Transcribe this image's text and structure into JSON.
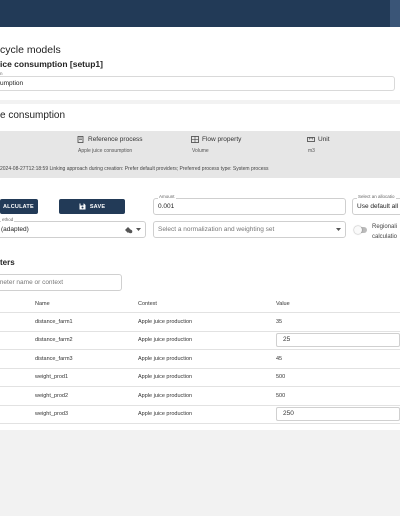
{
  "header": {
    "crumb_title": "cycle models",
    "crumb_subtitle": "ice consumption [setup1]",
    "field_label": "n",
    "field_value": "umption"
  },
  "main": {
    "section_title": "e consumption",
    "info": {
      "ref_process_label": "Reference process",
      "ref_process_value": "Apple juice consumption",
      "flow_property_label": "Flow property",
      "flow_property_value": "Volume",
      "unit_label": "Unit",
      "unit_value": "m3"
    },
    "linking_text": "2024-08-27T12:18:59 Linking approach during creation: Prefer default providers; Preferred process type: System process",
    "calculate_label": "ALCULATE",
    "save_label": "SAVE",
    "amount_label": "Amount",
    "amount_value": "0.001",
    "alloc_label": "Select an allocatio",
    "alloc_value": "Use default all",
    "method_label": "ethod",
    "method_value": " (adapted)",
    "norm_placeholder": "Select a normalization and weighting set",
    "regional_line1": "Regionali",
    "regional_line2": "calculatio"
  },
  "parameters": {
    "title": "ters",
    "search_placeholder": "meter name or context",
    "columns": {
      "name": "Name",
      "context": "Context",
      "value": "Value"
    },
    "rows": [
      {
        "name": "distance_farm1",
        "context": "Apple juice production",
        "value": "35",
        "editing": false
      },
      {
        "name": "distance_farm2",
        "context": "Apple juice production",
        "value": "25",
        "editing": true
      },
      {
        "name": "distance_farm3",
        "context": "Apple juice production",
        "value": "45",
        "editing": false
      },
      {
        "name": "weight_prod1",
        "context": "Apple juice production",
        "value": "500",
        "editing": false
      },
      {
        "name": "weight_prod2",
        "context": "Apple juice production",
        "value": "500",
        "editing": false
      },
      {
        "name": "weight_prod3",
        "context": "Apple juice production",
        "value": "250",
        "editing": true
      }
    ]
  },
  "colors": {
    "topbar": "#223a57",
    "button": "#223a57",
    "info_panel": "#e6e6e6"
  },
  "icons": [
    "process-icon",
    "flow-property-icon",
    "unit-icon",
    "calculate-icon",
    "save-icon",
    "method-options-icon",
    "dropdown-arrow-icon"
  ]
}
